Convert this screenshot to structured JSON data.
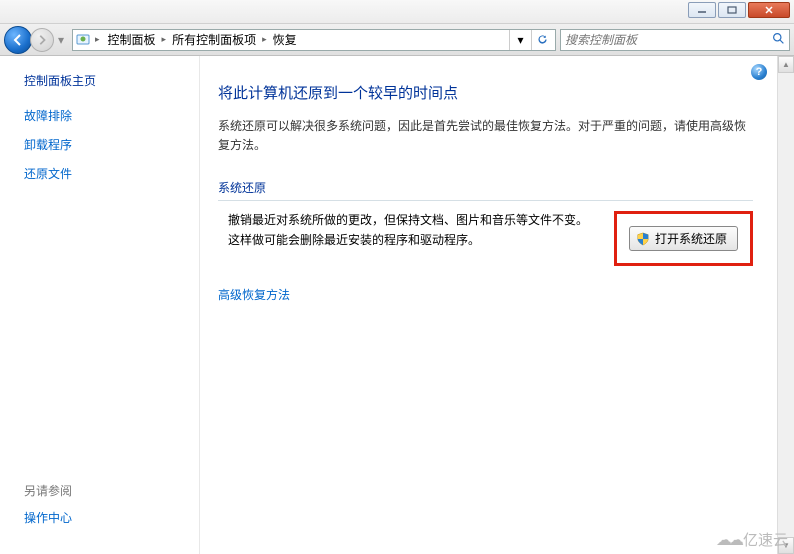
{
  "window": {
    "minimize_label": "Minimize",
    "maximize_label": "Maximize",
    "close_label": "Close"
  },
  "toolbar": {
    "breadcrumb": [
      {
        "label": "控制面板"
      },
      {
        "label": "所有控制面板项"
      },
      {
        "label": "恢复"
      }
    ],
    "refresh_label": "Refresh",
    "dropdown_label": "▾"
  },
  "search": {
    "placeholder": "搜索控制面板"
  },
  "sidebar": {
    "title": "控制面板主页",
    "links": [
      "故障排除",
      "卸载程序",
      "还原文件"
    ],
    "see_also_title": "另请参阅",
    "see_also_links": [
      "操作中心"
    ]
  },
  "content": {
    "help_label": "?",
    "title": "将此计算机还原到一个较早的时间点",
    "intro": "系统还原可以解决很多系统问题，因此是首先尝试的最佳恢复方法。对于严重的问题，请使用高级恢复方法。",
    "section_header": "系统还原",
    "restore_text": "撤销最近对系统所做的更改，但保持文档、图片和音乐等文件不变。这样做可能会删除最近安装的程序和驱动程序。",
    "restore_button": "打开系统还原",
    "advanced_link": "高级恢复方法"
  },
  "watermark": {
    "text": "亿速云"
  }
}
